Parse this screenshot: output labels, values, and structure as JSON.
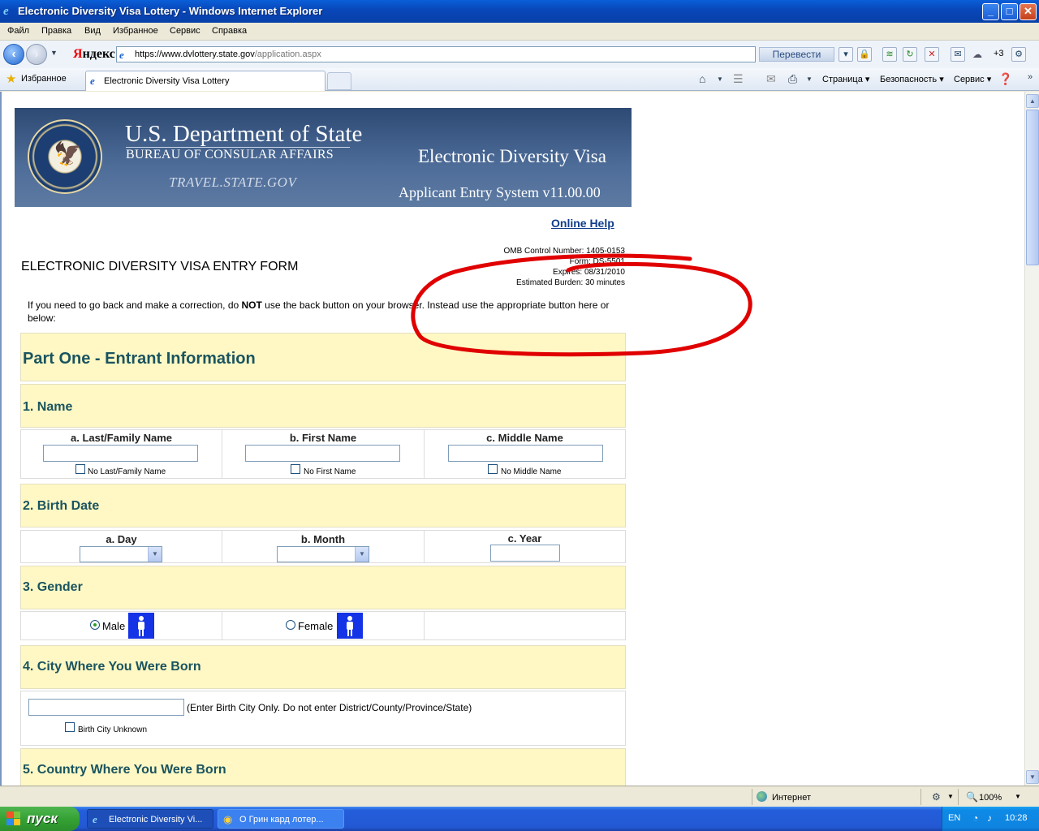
{
  "window": {
    "title": "Electronic Diversity Visa Lottery - Windows Internet Explorer",
    "min": "_",
    "max": "□",
    "close": "✕"
  },
  "menu": [
    "Файл",
    "Правка",
    "Вид",
    "Избранное",
    "Сервис",
    "Справка"
  ],
  "address": {
    "toolbar_brand_first": "Я",
    "toolbar_brand_rest": "ндекс",
    "url_prefix": "https://www.dvlottery.",
    "url_domain": "state.gov",
    "url_path": "/application.aspx",
    "translate_label": "Перевести",
    "plus_count": "+3"
  },
  "favorites": {
    "label": "Избранное",
    "tab_title": "Electronic Diversity Visa Lottery",
    "commands": [
      "Страница ▾",
      "Безопасность ▾",
      "Сервис ▾"
    ]
  },
  "banner": {
    "dept": "U.S. Department of State",
    "bureau": "BUREAU OF CONSULAR AFFAIRS",
    "travel": "TRAVEL.STATE.GOV",
    "edv": "Electronic Diversity Visa",
    "aes": "Applicant Entry System  v11.00.00"
  },
  "page": {
    "online_help": "Online Help",
    "omb": [
      "OMB Control Number: 1405-0153",
      "Form: DS-5501",
      "Expires: 08/31/2010",
      "Estimated Burden: 30 minutes"
    ],
    "form_title": "ELECTRONIC DIVERSITY VISA ENTRY FORM",
    "instr_pre": "If you need to go back and make a correction, do ",
    "instr_bold": "NOT",
    "instr_post": " use the back button on your browser. Instead use the appropriate button here or below:",
    "part_one": "Part One - Entrant Information",
    "s1": "1. Name",
    "s1_last": "a. Last/Family Name",
    "s1_first": "b. First Name",
    "s1_middle": "c. Middle Name",
    "s1_no_last": "No Last/Family Name",
    "s1_no_first": "No First Name",
    "s1_no_middle": "No Middle Name",
    "s2": "2. Birth Date",
    "s2_day": "a. Day",
    "s2_month": "b. Month",
    "s2_year": "c. Year",
    "s3": "3. Gender",
    "s3_male": "Male",
    "s3_female": "Female",
    "s4": "4. City Where You Were Born",
    "s4_hint": "(Enter Birth City Only. Do not enter District/County/Province/State)",
    "s4_unknown": "Birth City Unknown",
    "s5": "5. Country Where You Were Born"
  },
  "status": {
    "zone": "Интернет",
    "zoom": "100%"
  },
  "taskbar": {
    "start": "пуск",
    "task1": "Electronic Diversity Vi...",
    "task2": "О Грин кард лотер...",
    "lang": "EN",
    "time": "10:28"
  },
  "colors": {
    "section_bg": "#fff8c4",
    "section_title": "#1a5460",
    "banner_blue": "#3d5a86",
    "annotation_red": "#e00000"
  }
}
